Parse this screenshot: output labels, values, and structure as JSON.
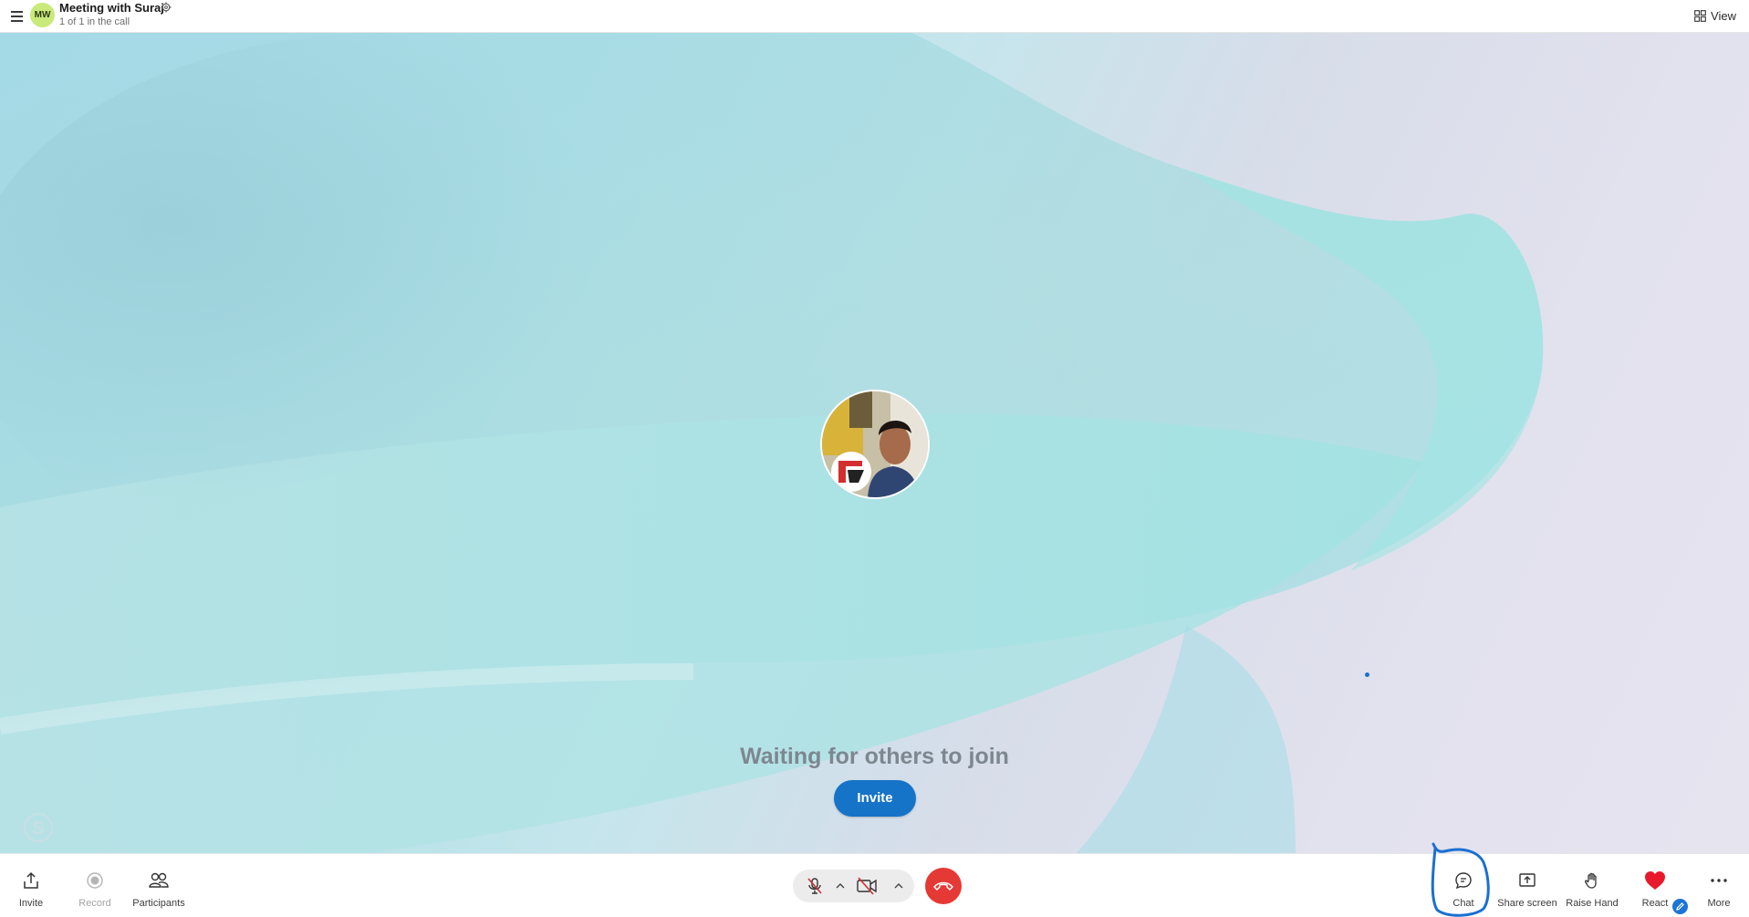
{
  "header": {
    "avatar_initials": "MW",
    "title": "Meeting with Suraj",
    "subtitle": "1 of 1 in the call",
    "view_label": "View"
  },
  "stage": {
    "waiting_text": "Waiting for others to join",
    "invite_label": "Invite"
  },
  "toolbar": {
    "left": [
      {
        "label": "Invite",
        "icon": "share-icon"
      },
      {
        "label": "Record",
        "icon": "record-icon",
        "disabled": true
      },
      {
        "label": "Participants",
        "icon": "participants-icon"
      }
    ],
    "center": {
      "mic_icon": "mic-off-icon",
      "camera_icon": "camera-off-icon",
      "end_call_icon": "phone-hangup-icon"
    },
    "right": [
      {
        "label": "Chat",
        "icon": "chat-icon"
      },
      {
        "label": "Share screen",
        "icon": "share-screen-icon"
      },
      {
        "label": "Raise Hand",
        "icon": "hand-icon"
      },
      {
        "label": "React",
        "icon": "heart-icon"
      },
      {
        "label": "More",
        "icon": "more-icon"
      }
    ]
  },
  "colors": {
    "accent": "#1573c8",
    "hangup": "#e53935",
    "react_heart": "#e8192c",
    "annotation": "#1b6fd1",
    "avatar_bg": "#c9ea7a"
  }
}
